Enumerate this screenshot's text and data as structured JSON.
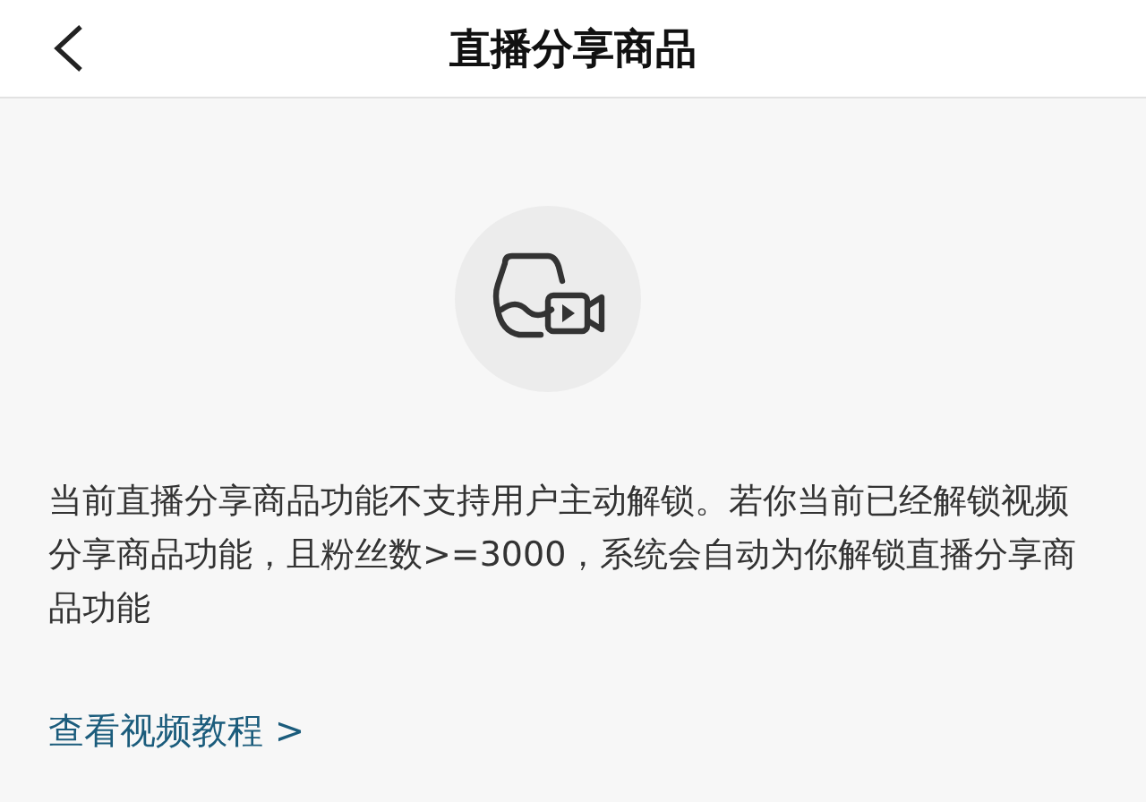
{
  "header": {
    "title": "直播分享商品"
  },
  "notice": {
    "text": "当前直播分享商品功能不支持用户主动解锁。若你当前已经解锁视频分享商品功能，且粉丝数>=3000，系统会自动为你解锁直播分享商品功能"
  },
  "link": {
    "label": "查看视频教程 >"
  }
}
